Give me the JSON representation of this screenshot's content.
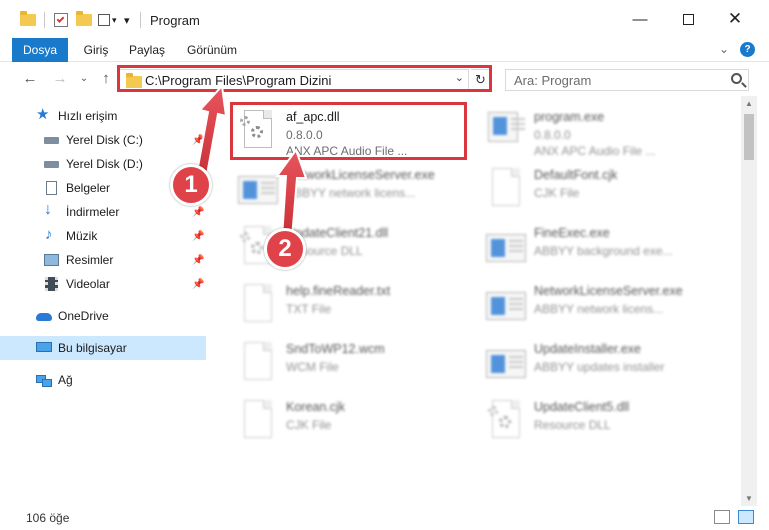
{
  "window": {
    "title": "Program"
  },
  "ribbon": {
    "tabs": [
      "Dosya",
      "Giriş",
      "Paylaş",
      "Görünüm"
    ],
    "help_label": "?"
  },
  "address": {
    "path": "C:\\Program Files\\Program Dizini"
  },
  "search": {
    "placeholder": "Ara: Program"
  },
  "sidebar": {
    "items": [
      {
        "label": "Hızlı erişim",
        "icon": "star-icon"
      },
      {
        "label": "Yerel Disk (C:)",
        "icon": "drive-icon",
        "pinned": true
      },
      {
        "label": "Yerel Disk (D:)",
        "icon": "drive-icon"
      },
      {
        "label": "Belgeler",
        "icon": "documents-icon"
      },
      {
        "label": "İndirmeler",
        "icon": "download-icon",
        "pinned": true
      },
      {
        "label": "Müzik",
        "icon": "music-icon",
        "pinned": true
      },
      {
        "label": "Resimler",
        "icon": "pictures-icon",
        "pinned": true
      },
      {
        "label": "Videolar",
        "icon": "videos-icon",
        "pinned": true
      },
      {
        "label": "OneDrive",
        "icon": "onedrive-icon"
      },
      {
        "label": "Bu bilgisayar",
        "icon": "computer-icon",
        "selected": true
      },
      {
        "label": "Ağ",
        "icon": "network-icon"
      }
    ]
  },
  "files": [
    {
      "name": "af_apc.dll",
      "line1": "0.8.0.0",
      "line2": "ANX APC Audio File ...",
      "icon": "dll-gear-icon",
      "highlight": true
    },
    {
      "name": "program.exe",
      "line1": "0.8.0.0",
      "line2": "ANX APC Audio File ...",
      "icon": "exe-icon"
    },
    {
      "name": "NetworkLicenseServer.exe",
      "line1": "ABBYY network licens...",
      "line2": "",
      "icon": "exe-icon"
    },
    {
      "name": "DefaultFont.cjk",
      "line1": "CJK File",
      "line2": "",
      "icon": "file-icon"
    },
    {
      "name": "UpdateClient21.dll",
      "line1": "Resource DLL",
      "line2": "",
      "icon": "dll-gear-icon"
    },
    {
      "name": "FineExec.exe",
      "line1": "ABBYY background exe...",
      "line2": "",
      "icon": "exe-icon"
    },
    {
      "name": "help.fineReader.txt",
      "line1": "TXT File",
      "line2": "",
      "icon": "file-icon"
    },
    {
      "name": "NetworkLicenseServer.exe",
      "line1": "ABBYY network licens...",
      "line2": "",
      "icon": "exe-icon"
    },
    {
      "name": "SndToWP12.wcm",
      "line1": "WCM File",
      "line2": "",
      "icon": "file-icon"
    },
    {
      "name": "UpdateInstaller.exe",
      "line1": "ABBYY updates installer",
      "line2": "",
      "icon": "exe-icon"
    },
    {
      "name": "Korean.cjk",
      "line1": "CJK File",
      "line2": "",
      "icon": "file-icon"
    },
    {
      "name": "UpdateClient5.dll",
      "line1": "Resource DLL",
      "line2": "",
      "icon": "dll-gear-icon"
    }
  ],
  "status": {
    "count": "106 öğe"
  },
  "callouts": [
    "1",
    "2"
  ],
  "colors": {
    "accent": "#1979ca",
    "highlight": "#d9363e",
    "selected_bg": "#cce8ff"
  }
}
